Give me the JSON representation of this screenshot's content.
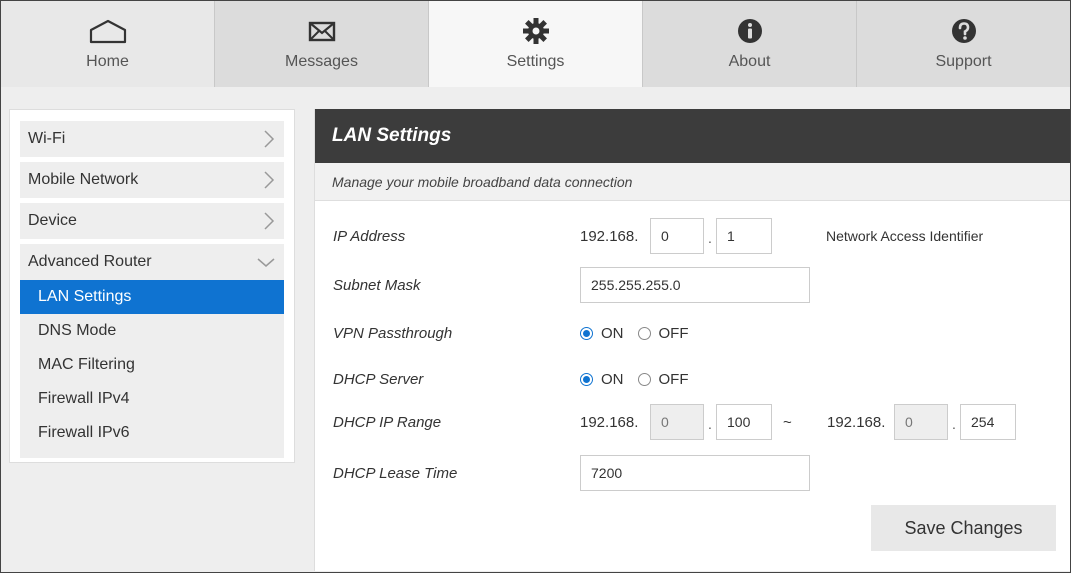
{
  "nav": {
    "tabs": [
      {
        "label": "Home",
        "icon": "home-icon"
      },
      {
        "label": "Messages",
        "icon": "envelope-icon"
      },
      {
        "label": "Settings",
        "icon": "gear-icon"
      },
      {
        "label": "About",
        "icon": "info-icon"
      },
      {
        "label": "Support",
        "icon": "question-icon"
      }
    ],
    "active": "Settings"
  },
  "sidebar": {
    "items": [
      {
        "label": "Wi-Fi"
      },
      {
        "label": "Mobile Network"
      },
      {
        "label": "Device"
      }
    ],
    "group": {
      "label": "Advanced Router",
      "items": [
        {
          "label": "LAN Settings",
          "active": true
        },
        {
          "label": "DNS Mode"
        },
        {
          "label": "MAC Filtering"
        },
        {
          "label": "Firewall IPv4"
        },
        {
          "label": "Firewall IPv6"
        }
      ]
    }
  },
  "panel": {
    "title": "LAN Settings",
    "subtitle": "Manage your mobile broadband data connection",
    "ip_address": {
      "label": "IP Address",
      "prefix": "192.168.",
      "octet3": "0",
      "octet4": "1",
      "note": "Network Access Identifier"
    },
    "subnet_mask": {
      "label": "Subnet Mask",
      "value": "255.255.255.0"
    },
    "vpn_passthrough": {
      "label": "VPN Passthrough",
      "on_label": "ON",
      "off_label": "OFF",
      "selected": "ON"
    },
    "dhcp_server": {
      "label": "DHCP Server",
      "on_label": "ON",
      "off_label": "OFF",
      "selected": "ON"
    },
    "dhcp_range": {
      "label": "DHCP IP Range",
      "start_prefix": "192.168.",
      "start_octet3": "0",
      "start_octet4": "100",
      "separator": "~",
      "end_prefix": "192.168.",
      "end_octet3": "0",
      "end_octet4": "254"
    },
    "lease_time": {
      "label": "DHCP Lease Time",
      "value": "7200"
    },
    "save_label": "Save Changes"
  },
  "colors": {
    "accent": "#0f73d1",
    "header_bg": "#3c3c3c"
  }
}
